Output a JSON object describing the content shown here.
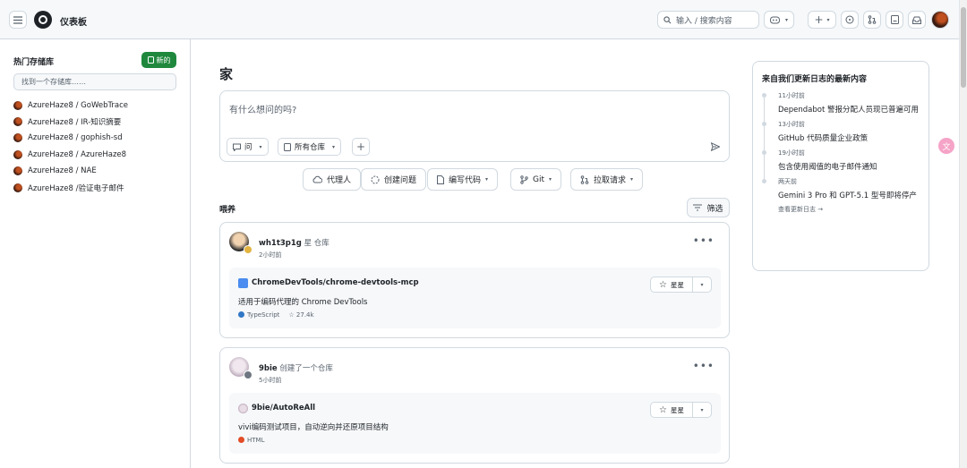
{
  "header": {
    "title": "仪表板",
    "search_placeholder": "输入 / 搜索内容",
    "icons": [
      "menu-icon",
      "github-logo",
      "search-icon",
      "copilot-icon",
      "plus-icon",
      "issues-icon",
      "pull-request-icon",
      "projects-icon",
      "inbox-icon"
    ]
  },
  "sidebar": {
    "title": "热门存储库",
    "new_label": "新的",
    "find_placeholder": "找到一个存储库……",
    "repos": [
      "AzureHaze8 / GoWebTrace",
      "AzureHaze8 / IR-知识摘要",
      "AzureHaze8 / gophish-sd",
      "AzureHaze8 / AzureHaze8",
      "AzureHaze8 / NAE",
      "AzureHaze8 /验证电子邮件"
    ]
  },
  "main": {
    "title": "家",
    "ask_placeholder": "有什么想问的吗?",
    "ask_button": "问",
    "repos_button": "所有仓库",
    "pills": [
      "代理人",
      "创建问题",
      "编写代码",
      "Git",
      "拉取请求"
    ],
    "feed_title": "喂养",
    "filter_label": "筛选"
  },
  "feed": [
    {
      "user": "wh1t3p1g",
      "action": "星 仓库",
      "time": "2小时前",
      "repo": "ChromeDevTools/chrome-devtools-mcp",
      "description": "适用于编码代理的 Chrome DevTools",
      "language": "TypeScript",
      "language_color": "#3178c6",
      "stars": "27.4k",
      "star_label": "星星"
    },
    {
      "user": "9bie",
      "action": "创建了一个仓库",
      "time": "5小时前",
      "repo": "9bie/AutoReAll",
      "description": "vivi编码测试项目，自动逆向并还原项目结构",
      "language": "HTML",
      "language_color": "#e34c26",
      "star_label": "星星"
    }
  ],
  "changelog": {
    "title": "来自我们更新日志的最新内容",
    "items": [
      {
        "date": "11小时前",
        "text": "Dependabot 警报分配人员现已普遍可用"
      },
      {
        "date": "13小时前",
        "text": "GitHub 代码质量企业政策"
      },
      {
        "date": "19小时前",
        "text": "包含使用阈值的电子邮件通知"
      },
      {
        "date": "两天前",
        "text": "Gemini 3 Pro 和 GPT-5.1 型号即将停产"
      }
    ],
    "view_more": "查看更新日志 →"
  },
  "colors": {
    "accent_green": "#1f883d",
    "border": "#d1d9e0",
    "muted": "#59636e"
  }
}
